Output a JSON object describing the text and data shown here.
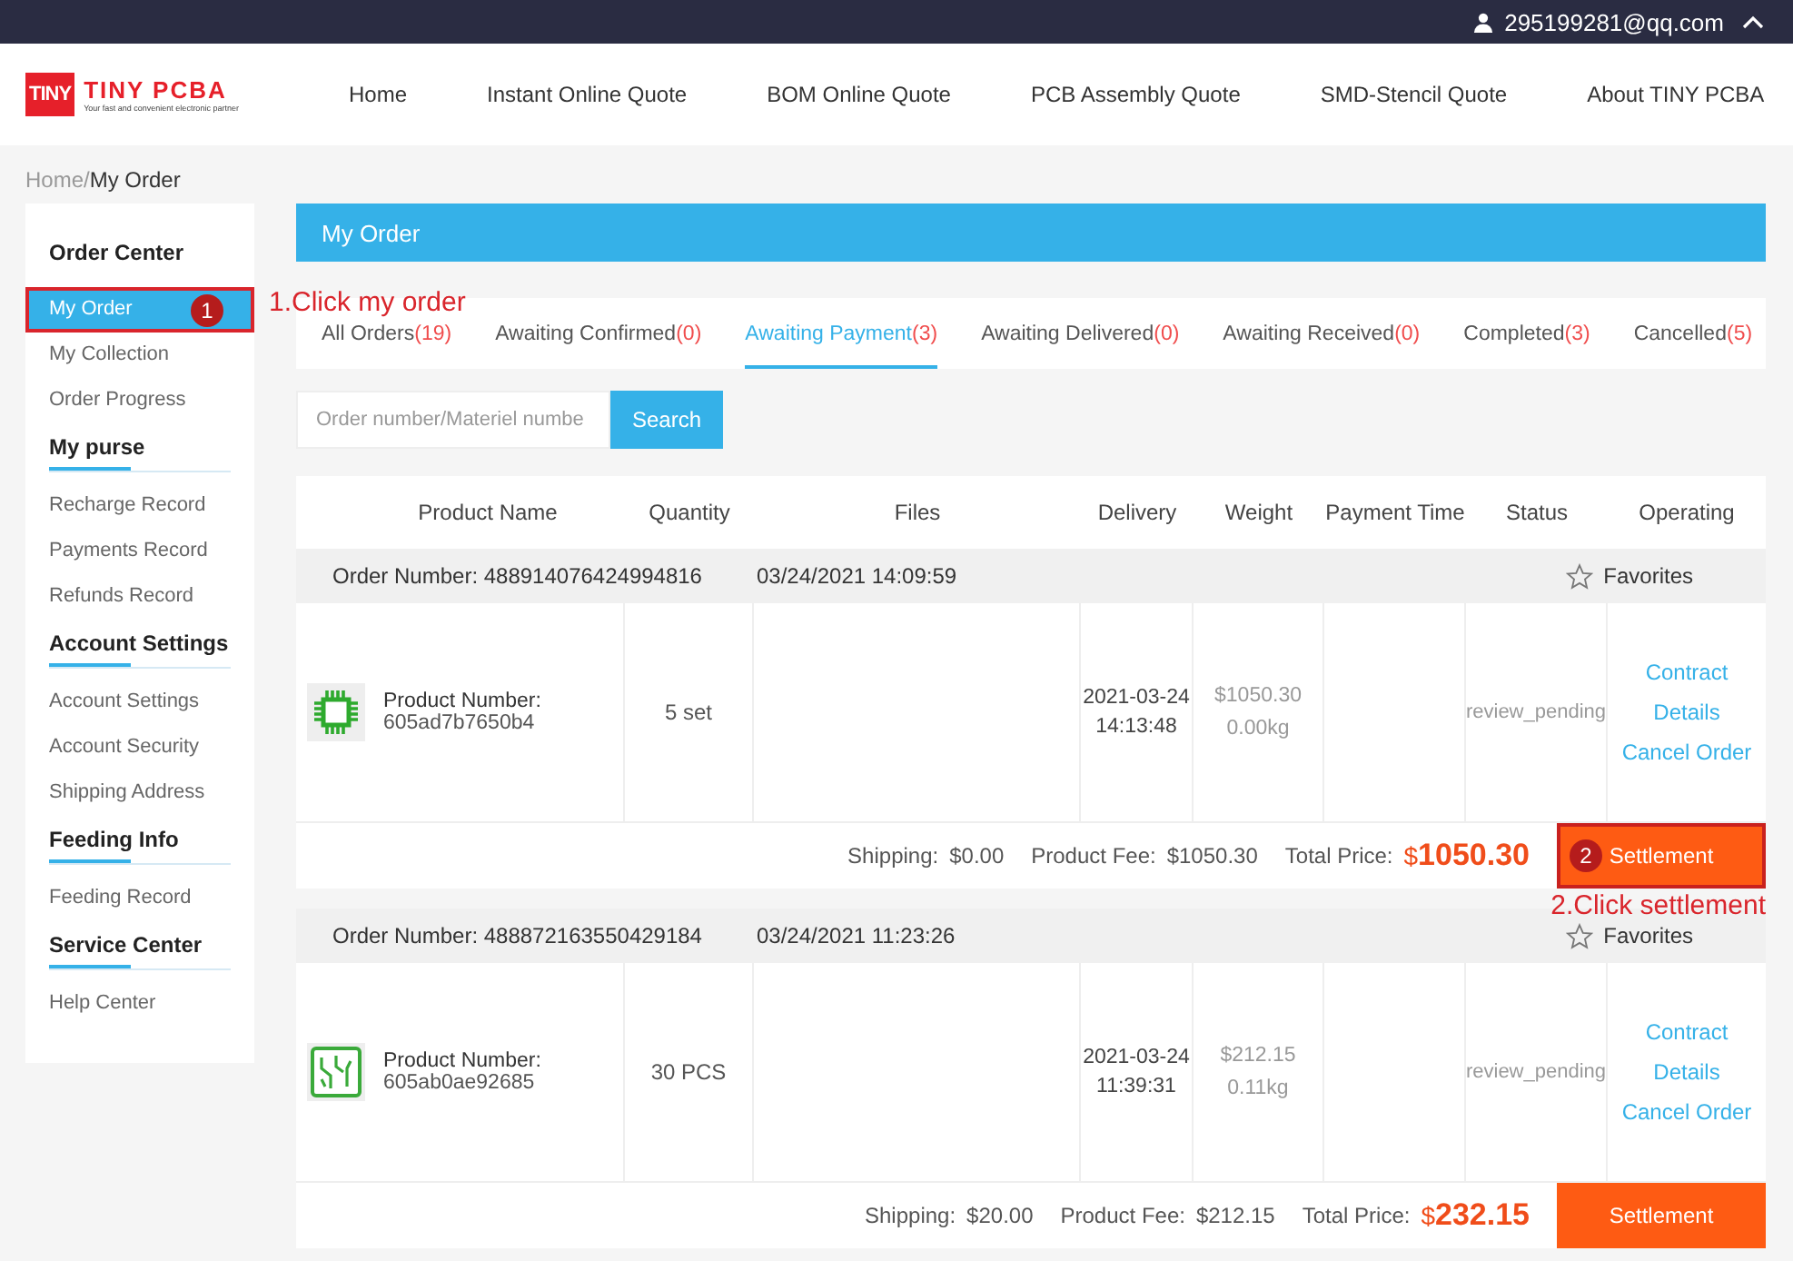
{
  "top_bar": {
    "user": "295199281@qq.com"
  },
  "header": {
    "logo": {
      "mark": "TINY",
      "name": "TINY PCBA",
      "tagline": "Your fast and convenient electronic partner"
    },
    "nav": [
      "Home",
      "Instant Online Quote",
      "BOM Online Quote",
      "PCB Assembly Quote",
      "SMD-Stencil Quote",
      "About TINY PCBA"
    ]
  },
  "breadcrumb": {
    "parent": "Home/",
    "current": "My Order"
  },
  "sidebar": {
    "sections": [
      {
        "heading": "Order Center",
        "divider": false,
        "items": [
          {
            "label": "My Order",
            "selected": true,
            "step": "1",
            "note": "1.Click my order"
          },
          {
            "label": "My Collection",
            "selected": false
          },
          {
            "label": "Order Progress",
            "selected": false
          }
        ]
      },
      {
        "heading": "My purse",
        "divider": true,
        "items": [
          {
            "label": "Recharge Record",
            "selected": false
          },
          {
            "label": "Payments Record",
            "selected": false
          },
          {
            "label": "Refunds Record",
            "selected": false
          }
        ]
      },
      {
        "heading": "Account Settings",
        "divider": true,
        "items": [
          {
            "label": "Account Settings",
            "selected": false
          },
          {
            "label": "Account Security",
            "selected": false
          },
          {
            "label": "Shipping Address",
            "selected": false
          }
        ]
      },
      {
        "heading": "Feeding Info",
        "divider": true,
        "items": [
          {
            "label": "Feeding Record",
            "selected": false
          }
        ]
      },
      {
        "heading": "Service Center",
        "divider": true,
        "items": [
          {
            "label": "Help Center",
            "selected": false
          }
        ]
      }
    ]
  },
  "main": {
    "title": "My Order",
    "tabs": [
      {
        "label": "All Orders",
        "count": "(19)",
        "selected": false
      },
      {
        "label": "Awaiting Confirmed",
        "count": "(0)",
        "selected": false
      },
      {
        "label": "Awaiting Payment",
        "count": "(3)",
        "selected": true
      },
      {
        "label": "Awaiting Delivered",
        "count": "(0)",
        "selected": false
      },
      {
        "label": "Awaiting Received",
        "count": "(0)",
        "selected": false
      },
      {
        "label": "Completed",
        "count": "(3)",
        "selected": false
      },
      {
        "label": "Cancelled",
        "count": "(5)",
        "selected": false
      }
    ],
    "search": {
      "placeholder": "Order number/Materiel numbe",
      "button": "Search"
    },
    "table": {
      "columns": [
        "Product Name",
        "Quantity",
        "Files",
        "Delivery",
        "Weight",
        "Payment Time",
        "Status",
        "Operating"
      ],
      "orders": [
        {
          "order_number": "Order Number: 488914076424994816",
          "date": "03/24/2021 14:09:59",
          "favorite": "Favorites",
          "product": {
            "kind": "chip",
            "label": "Product Number:",
            "number": "605ad7b7650b4"
          },
          "quantity": "5 set",
          "delivery": [
            "2021-03-24",
            "14:13:48"
          ],
          "price": "$1050.30",
          "weight": "0.00kg",
          "status": "review_pending",
          "actions": [
            "Contract",
            "Details",
            "Cancel Order"
          ],
          "shipping_label": "Shipping:",
          "shipping": "$0.00",
          "fee_label": "Product Fee:",
          "fee": "$1050.30",
          "total_label": "Total Price:",
          "total_currency": "$",
          "total": "1050.30",
          "settlement": {
            "label": "Settlement",
            "step": "2",
            "note": "2.Click settlement"
          }
        },
        {
          "order_number": "Order Number: 488872163550429184",
          "date": "03/24/2021 11:23:26",
          "favorite": "Favorites",
          "product": {
            "kind": "board",
            "label": "Product Number:",
            "number": "605ab0ae92685"
          },
          "quantity": "30 PCS",
          "delivery": [
            "2021-03-24",
            "11:39:31"
          ],
          "price": "$212.15",
          "weight": "0.11kg",
          "status": "review_pending",
          "actions": [
            "Contract",
            "Details",
            "Cancel Order"
          ],
          "shipping_label": "Shipping:",
          "shipping": "$20.00",
          "fee_label": "Product Fee:",
          "fee": "$212.15",
          "total_label": "Total Price:",
          "total_currency": "$",
          "total": "232.15",
          "settlement": {
            "label": "Settlement"
          }
        }
      ]
    }
  }
}
